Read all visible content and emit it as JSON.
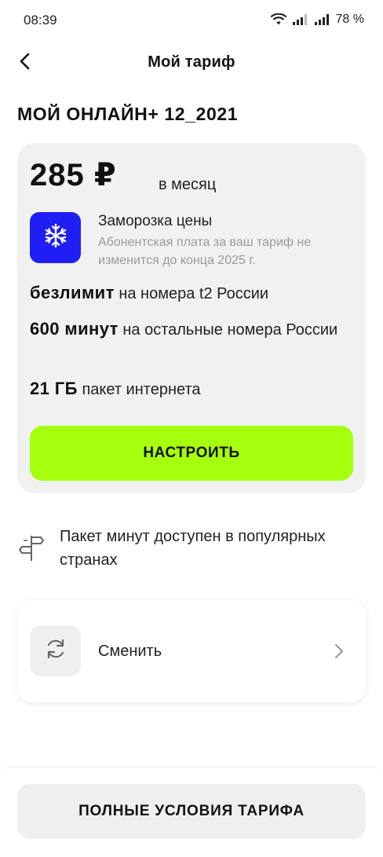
{
  "status_bar": {
    "time": "08:39",
    "battery": "78 %"
  },
  "header": {
    "title": "Мой тариф"
  },
  "plan": {
    "name": "МОЙ ОНЛАЙН+ 12_2021",
    "price": "285 ₽",
    "price_unit": "в месяц",
    "freeze": {
      "title": "Заморозка цены",
      "description": "Абонентская плата за ваш тариф не изменится до конца 2025 г."
    },
    "features": [
      {
        "bold": "безлимит",
        "text": "на номера t2 России"
      },
      {
        "bold": "600 минут",
        "text": "на остальные номера России"
      },
      {
        "bold": "21 ГБ",
        "text": "пакет интернета"
      }
    ],
    "configure_label": "НАСТРОИТЬ"
  },
  "note": {
    "text": "Пакет минут доступен в популярных странах"
  },
  "change": {
    "label": "Сменить"
  },
  "bottom": {
    "full_terms_label": "ПОЛНЫЕ УСЛОВИЯ ТАРИФА"
  },
  "colors": {
    "accent_green": "#a6ff0d",
    "freeze_blue": "#1f1ff5",
    "card_gray": "#f1f1f1"
  },
  "icons": [
    "wifi-icon",
    "signal-icon",
    "back-arrow-icon",
    "snowflake-icon",
    "signpost-icon",
    "refresh-icon",
    "chevron-right-icon"
  ]
}
